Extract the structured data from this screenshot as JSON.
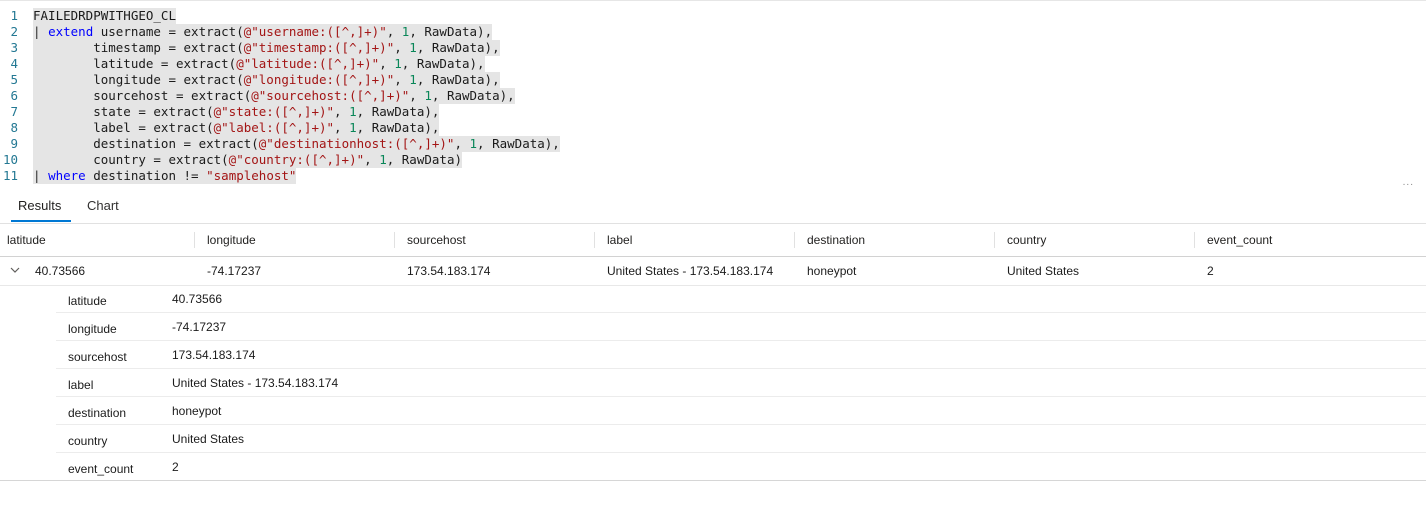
{
  "editor": {
    "lines": [
      {
        "num": "1",
        "segments": [
          {
            "t": "FAILEDRDPWITHGEO_CL",
            "c": "txt"
          }
        ]
      },
      {
        "num": "2",
        "segments": [
          {
            "t": "| ",
            "c": "pipe"
          },
          {
            "t": "extend",
            "c": "kw"
          },
          {
            "t": " username = extract(",
            "c": "txt"
          },
          {
            "t": "@\"username:([^,]+)\"",
            "c": "str"
          },
          {
            "t": ", ",
            "c": "txt"
          },
          {
            "t": "1",
            "c": "num"
          },
          {
            "t": ", RawData),",
            "c": "txt"
          }
        ]
      },
      {
        "num": "3",
        "segments": [
          {
            "t": "        timestamp = extract(",
            "c": "txt"
          },
          {
            "t": "@\"timestamp:([^,]+)\"",
            "c": "str"
          },
          {
            "t": ", ",
            "c": "txt"
          },
          {
            "t": "1",
            "c": "num"
          },
          {
            "t": ", RawData),",
            "c": "txt"
          }
        ]
      },
      {
        "num": "4",
        "segments": [
          {
            "t": "        latitude = extract(",
            "c": "txt"
          },
          {
            "t": "@\"latitude:([^,]+)\"",
            "c": "str"
          },
          {
            "t": ", ",
            "c": "txt"
          },
          {
            "t": "1",
            "c": "num"
          },
          {
            "t": ", RawData),",
            "c": "txt"
          }
        ]
      },
      {
        "num": "5",
        "segments": [
          {
            "t": "        longitude = extract(",
            "c": "txt"
          },
          {
            "t": "@\"longitude:([^,]+)\"",
            "c": "str"
          },
          {
            "t": ", ",
            "c": "txt"
          },
          {
            "t": "1",
            "c": "num"
          },
          {
            "t": ", RawData),",
            "c": "txt"
          }
        ]
      },
      {
        "num": "6",
        "segments": [
          {
            "t": "        sourcehost = extract(",
            "c": "txt"
          },
          {
            "t": "@\"sourcehost:([^,]+)\"",
            "c": "str"
          },
          {
            "t": ", ",
            "c": "txt"
          },
          {
            "t": "1",
            "c": "num"
          },
          {
            "t": ", RawData),",
            "c": "txt"
          }
        ]
      },
      {
        "num": "7",
        "segments": [
          {
            "t": "        state = extract(",
            "c": "txt"
          },
          {
            "t": "@\"state:([^,]+)\"",
            "c": "str"
          },
          {
            "t": ", ",
            "c": "txt"
          },
          {
            "t": "1",
            "c": "num"
          },
          {
            "t": ", RawData),",
            "c": "txt"
          }
        ]
      },
      {
        "num": "8",
        "segments": [
          {
            "t": "        label = extract(",
            "c": "txt"
          },
          {
            "t": "@\"label:([^,]+)\"",
            "c": "str"
          },
          {
            "t": ", ",
            "c": "txt"
          },
          {
            "t": "1",
            "c": "num"
          },
          {
            "t": ", RawData),",
            "c": "txt"
          }
        ]
      },
      {
        "num": "9",
        "segments": [
          {
            "t": "        destination = extract(",
            "c": "txt"
          },
          {
            "t": "@\"destinationhost:([^,]+)\"",
            "c": "str"
          },
          {
            "t": ", ",
            "c": "txt"
          },
          {
            "t": "1",
            "c": "num"
          },
          {
            "t": ", RawData),",
            "c": "txt"
          }
        ]
      },
      {
        "num": "10",
        "segments": [
          {
            "t": "        country = extract(",
            "c": "txt"
          },
          {
            "t": "@\"country:([^,]+)\"",
            "c": "str"
          },
          {
            "t": ", ",
            "c": "txt"
          },
          {
            "t": "1",
            "c": "num"
          },
          {
            "t": ", RawData)",
            "c": "txt"
          }
        ]
      },
      {
        "num": "11",
        "segments": [
          {
            "t": "| ",
            "c": "pipe"
          },
          {
            "t": "where",
            "c": "kw"
          },
          {
            "t": " destination != ",
            "c": "txt"
          },
          {
            "t": "\"samplehost\"",
            "c": "str"
          }
        ]
      }
    ],
    "more_glyph": "..."
  },
  "tabs": {
    "results": "Results",
    "chart": "Chart"
  },
  "columns": [
    "latitude",
    "longitude",
    "sourcehost",
    "label",
    "destination",
    "country",
    "event_count"
  ],
  "row": {
    "latitude": "40.73566",
    "longitude": "-74.17237",
    "sourcehost": "173.54.183.174",
    "label": "United States - 173.54.183.174",
    "destination": "honeypot",
    "country": "United States",
    "event_count": "2"
  },
  "details": [
    {
      "key": "latitude",
      "value": "40.73566"
    },
    {
      "key": "longitude",
      "value": "-74.17237"
    },
    {
      "key": "sourcehost",
      "value": "173.54.183.174"
    },
    {
      "key": "label",
      "value": "United States - 173.54.183.174"
    },
    {
      "key": "destination",
      "value": "honeypot"
    },
    {
      "key": "country",
      "value": "United States"
    },
    {
      "key": "event_count",
      "value": "2"
    }
  ],
  "colors": {
    "keyword": "#0000ff",
    "string": "#a31515",
    "number": "#098658",
    "line_number": "#237893",
    "accent": "#0078d4",
    "code_highlight": "#e5e5e5"
  }
}
